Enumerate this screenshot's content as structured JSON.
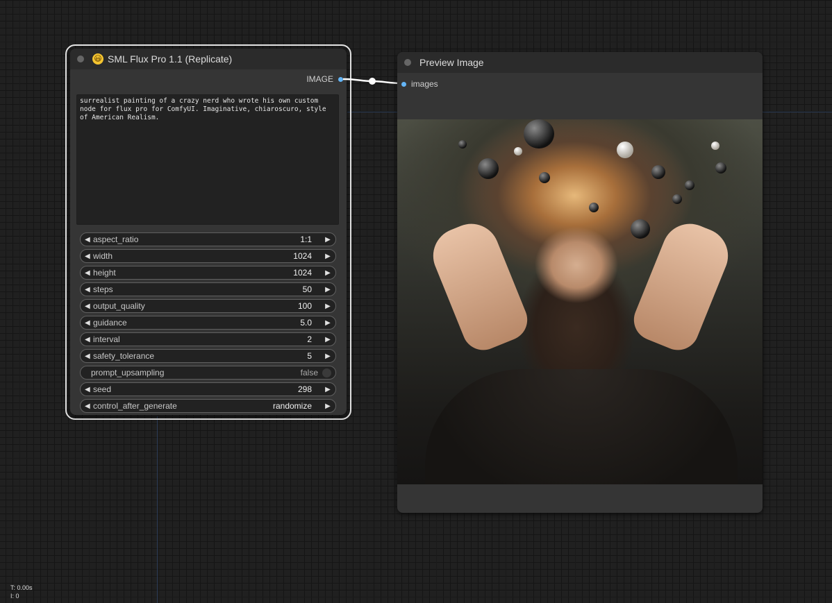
{
  "sml_node": {
    "emoji": "😃",
    "title": "SML Flux Pro 1.1 (Replicate)",
    "output_label": "IMAGE",
    "prompt": "surrealist painting of a crazy nerd who wrote his own custom node for flux pro for ComfyUI. Imaginative, chiaroscuro, style of American Realism.",
    "widgets": [
      {
        "label": "aspect_ratio",
        "value": "1:1"
      },
      {
        "label": "width",
        "value": "1024"
      },
      {
        "label": "height",
        "value": "1024"
      },
      {
        "label": "steps",
        "value": "50"
      },
      {
        "label": "output_quality",
        "value": "100"
      },
      {
        "label": "guidance",
        "value": "5.0"
      },
      {
        "label": "interval",
        "value": "2"
      },
      {
        "label": "safety_tolerance",
        "value": "5"
      },
      {
        "label": "prompt_upsampling",
        "value": "false"
      },
      {
        "label": "seed",
        "value": "298"
      },
      {
        "label": "control_after_generate",
        "value": "randomize"
      }
    ]
  },
  "preview_node": {
    "title": "Preview Image",
    "input_label": "images"
  },
  "stats": {
    "time": "T: 0.00s",
    "items": "I: 0"
  },
  "colors": {
    "slot": "#64b5f6",
    "link": "#ffffff",
    "selected_outline": "#e8e8e8"
  }
}
